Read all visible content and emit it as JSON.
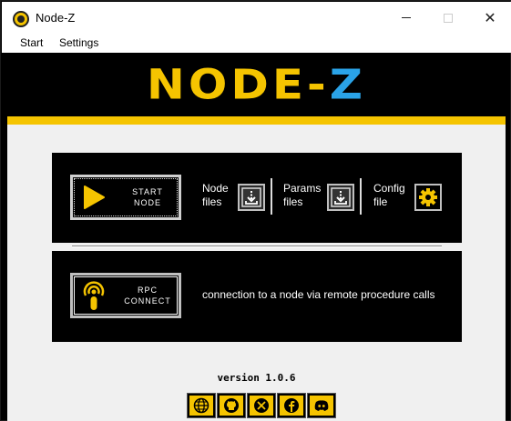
{
  "window": {
    "title": "Node-Z",
    "minimize_glyph": "",
    "close_glyph": "✕"
  },
  "menu": {
    "start": "Start",
    "settings": "Settings"
  },
  "banner": {
    "logo_main": "NODE-",
    "logo_accent": "Z",
    "colors": {
      "yellow": "#f5c400",
      "blue": "#2aa3e8",
      "black": "#000000"
    }
  },
  "node_panel": {
    "start_button": {
      "line1": "START",
      "line2": "NODE",
      "icon": "play-icon"
    },
    "node_files": {
      "line1": "Node",
      "line2": "files",
      "icon": "download-icon"
    },
    "params_files": {
      "line1": "Params",
      "line2": "files",
      "icon": "download-icon"
    },
    "config_file": {
      "line1": "Config",
      "line2": "file",
      "icon": "gear-icon"
    }
  },
  "rpc_panel": {
    "button": {
      "line1": "RPC",
      "line2": "CONNECT",
      "icon": "antenna-icon"
    },
    "description": "connection to a node via remote procedure calls"
  },
  "footer": {
    "version": "version 1.0.6",
    "socials": [
      {
        "name": "website",
        "icon": "globe-icon"
      },
      {
        "name": "github",
        "icon": "github-icon"
      },
      {
        "name": "x",
        "icon": "x-icon"
      },
      {
        "name": "facebook",
        "icon": "facebook-icon"
      },
      {
        "name": "discord",
        "icon": "discord-icon"
      }
    ]
  }
}
